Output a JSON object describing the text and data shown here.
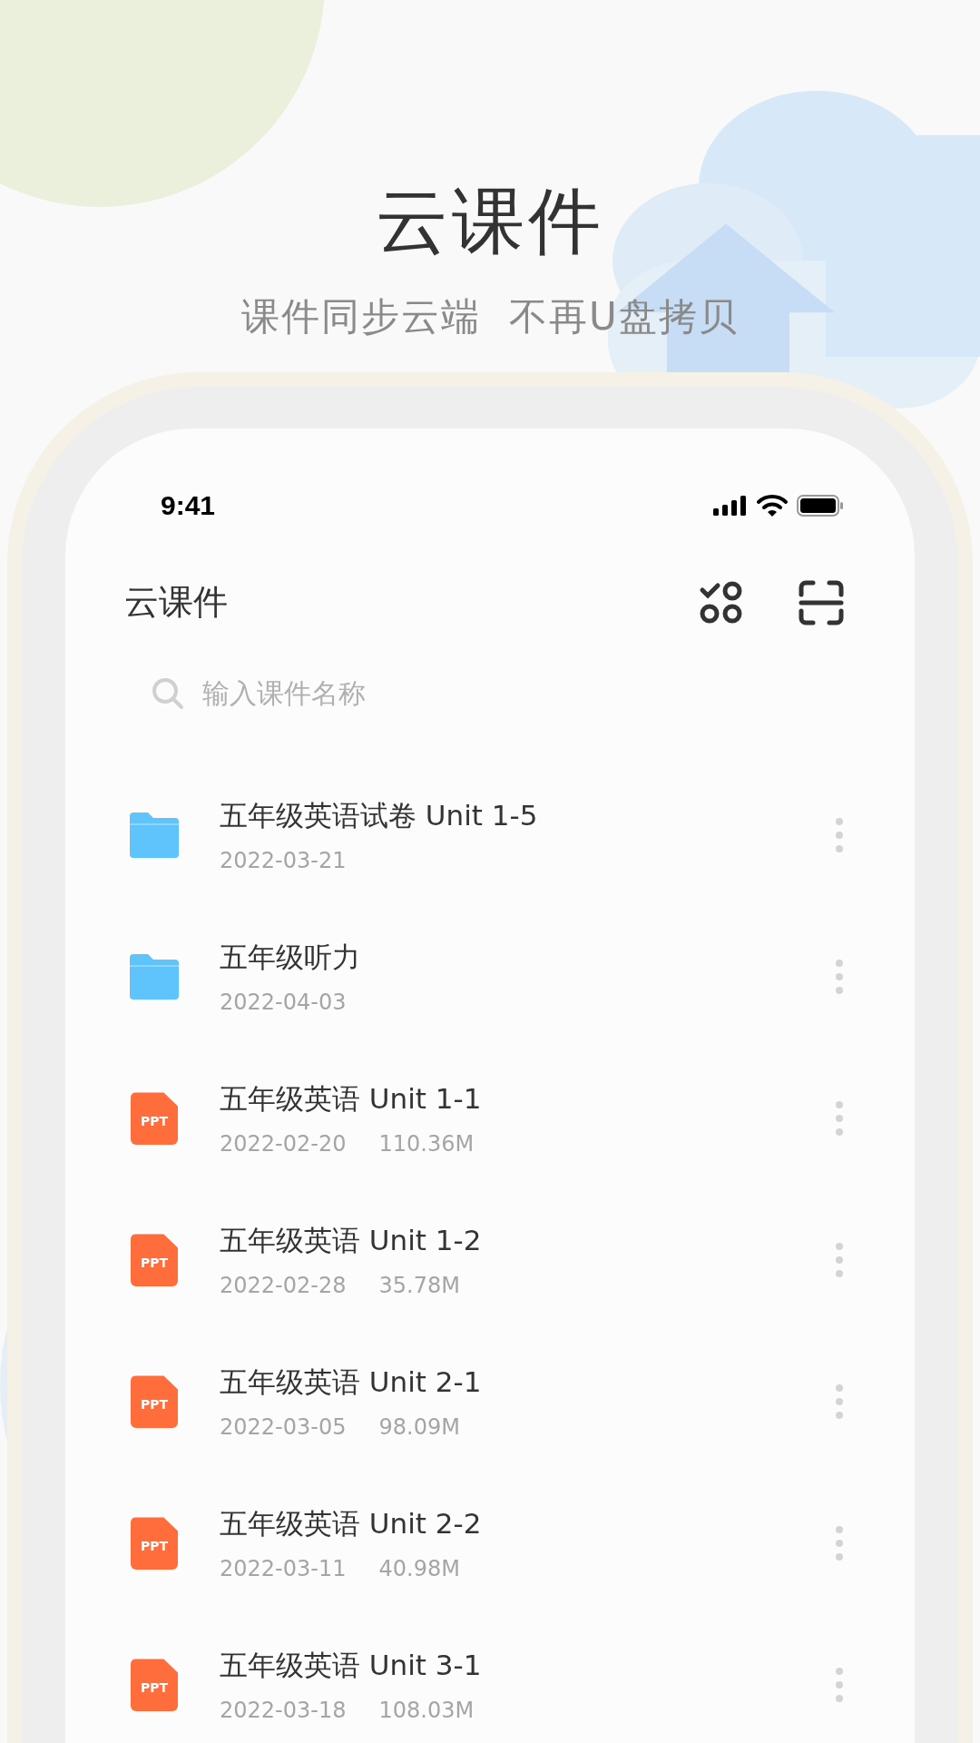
{
  "headline": {
    "title": "云课件",
    "subtitle": "课件同步云端  不再U盘拷贝"
  },
  "status_bar": {
    "time": "9:41"
  },
  "app_bar": {
    "title": "云课件"
  },
  "search": {
    "placeholder": "输入课件名称"
  },
  "files": [
    {
      "kind": "folder",
      "name": "五年级英语试卷 Unit 1-5",
      "date": "2022-03-21"
    },
    {
      "kind": "folder",
      "name": "五年级听力",
      "date": "2022-04-03"
    },
    {
      "kind": "ppt",
      "icon_label": "PPT",
      "name": "五年级英语 Unit 1-1",
      "date": "2022-02-20",
      "size": "110.36M"
    },
    {
      "kind": "ppt",
      "icon_label": "PPT",
      "name": "五年级英语 Unit 1-2",
      "date": "2022-02-28",
      "size": "35.78M"
    },
    {
      "kind": "ppt",
      "icon_label": "PPT",
      "name": "五年级英语 Unit 2-1",
      "date": "2022-03-05",
      "size": "98.09M"
    },
    {
      "kind": "ppt",
      "icon_label": "PPT",
      "name": "五年级英语 Unit 2-2",
      "date": "2022-03-11",
      "size": "40.98M"
    },
    {
      "kind": "ppt",
      "icon_label": "PPT",
      "name": "五年级英语 Unit 3-1",
      "date": "2022-03-18",
      "size": "108.03M"
    }
  ]
}
